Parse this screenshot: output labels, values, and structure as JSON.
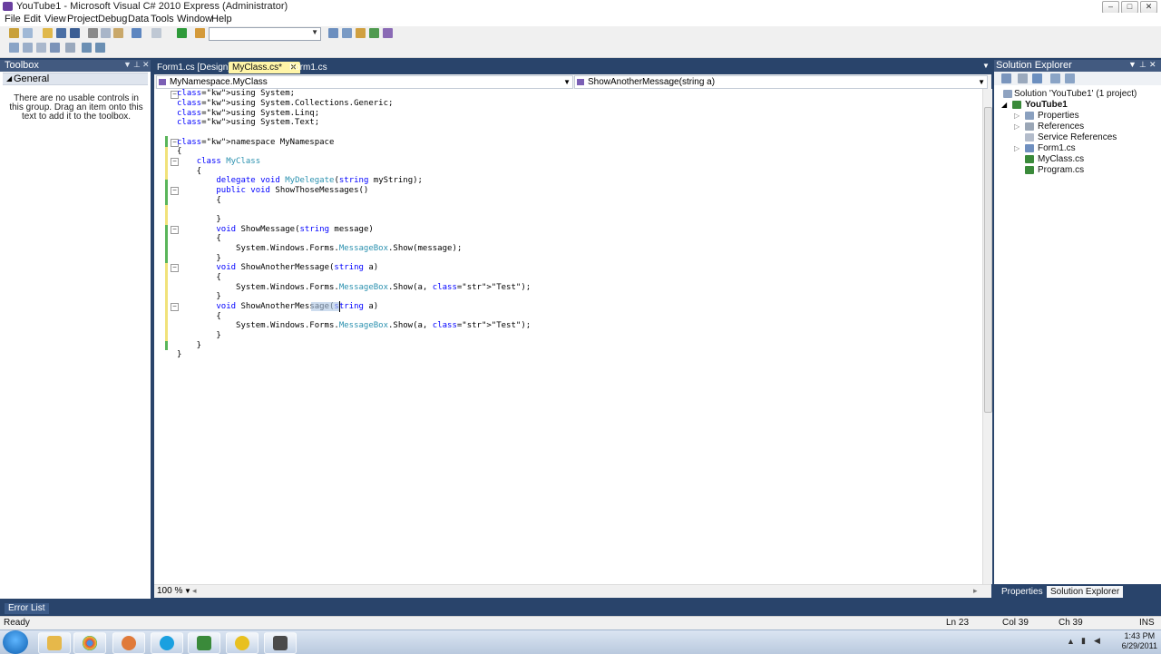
{
  "window": {
    "title": "YouTube1 - Microsoft Visual C# 2010 Express (Administrator)"
  },
  "menu": [
    "File",
    "Edit",
    "View",
    "Project",
    "Debug",
    "Data",
    "Tools",
    "Window",
    "Help"
  ],
  "toolbox": {
    "title": "Toolbox",
    "group": "General",
    "empty_text": "There are no usable controls in this group. Drag an item onto this text to add it to the toolbox."
  },
  "tabs": [
    {
      "label": "Form1.cs [Design]"
    },
    {
      "label": "MyClass.cs*"
    },
    {
      "label": "Form1.cs"
    }
  ],
  "nav": {
    "class_combo": "MyNamespace.MyClass",
    "member_combo": "ShowAnotherMessage(string a)"
  },
  "code_lines": [
    "using System;",
    "using System.Collections.Generic;",
    "using System.Linq;",
    "using System.Text;",
    "",
    "namespace MyNamespace",
    "{",
    "    class MyClass",
    "    {",
    "        delegate void MyDelegate(string myString);",
    "        public void ShowThoseMessages()",
    "        {",
    "",
    "        }",
    "        void ShowMessage(string message)",
    "        {",
    "            System.Windows.Forms.MessageBox.Show(message);",
    "        }",
    "        void ShowAnotherMessage(string a)",
    "        {",
    "            System.Windows.Forms.MessageBox.Show(a, \"Test\");",
    "        }",
    "        void ShowAnotherMessage(string a)",
    "        {",
    "            System.Windows.Forms.MessageBox.Show(a, \"Test\");",
    "        }",
    "    }",
    "}"
  ],
  "zoom": "100 %",
  "solution_explorer": {
    "title": "Solution Explorer",
    "items": [
      {
        "label": "Solution 'YouTube1' (1 project)"
      },
      {
        "label": "YouTube1"
      },
      {
        "label": "Properties"
      },
      {
        "label": "References"
      },
      {
        "label": "Service References"
      },
      {
        "label": "Form1.cs"
      },
      {
        "label": "MyClass.cs"
      },
      {
        "label": "Program.cs"
      }
    ],
    "bottom_tabs": [
      "Properties",
      "Solution Explorer"
    ]
  },
  "error_list": "Error List",
  "status": {
    "left": "Ready",
    "ln": "Ln 23",
    "col": "Col 39",
    "ch": "Ch 39",
    "ins": "INS"
  },
  "clock": {
    "time": "1:43 PM",
    "date": "6/29/2011"
  },
  "colors": {
    "chrome": "#29446b",
    "panel_header": "#425a80",
    "active_tab": "#fff5a8",
    "keyword": "#0000ff",
    "type": "#2b91af",
    "string": "#a31515"
  }
}
